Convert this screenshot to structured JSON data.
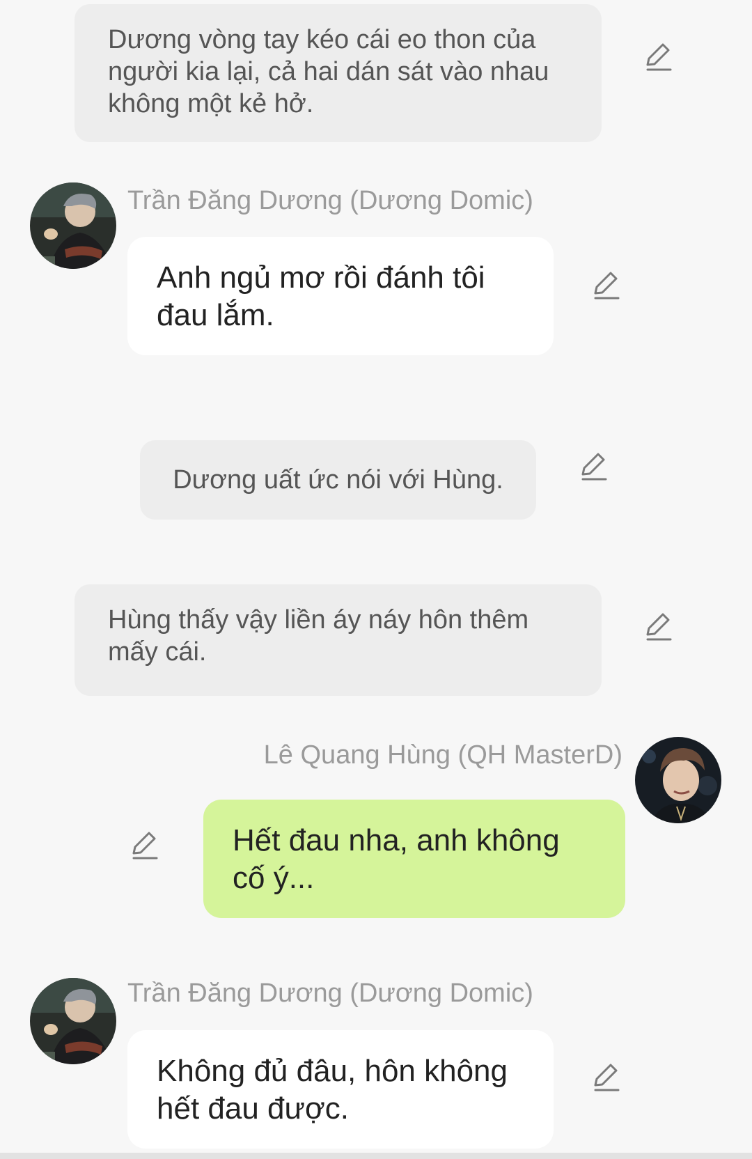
{
  "messages": [
    {
      "type": "narration",
      "text": "Dương vòng tay kéo cái eo thon của người kia lại, cả hai dán sát vào nhau không một kẻ hở."
    },
    {
      "type": "incoming",
      "sender": "Trần Đăng Dương (Dương Domic)",
      "text": "Anh ngủ mơ rồi đánh tôi đau lắm."
    },
    {
      "type": "narration",
      "text": "Dương uất ức nói với Hùng."
    },
    {
      "type": "narration",
      "text": "Hùng thấy vậy liền áy náy hôn thêm mấy cái."
    },
    {
      "type": "outgoing",
      "sender": "Lê Quang Hùng (QH MasterD)",
      "text": "Hết đau nha, anh không cố ý..."
    },
    {
      "type": "incoming",
      "sender": "Trần Đăng Dương (Dương Domic)",
      "text": "Không đủ đâu, hôn không hết đau được."
    }
  ],
  "icons": {
    "edit": "pencil-icon",
    "avatar": "avatar-photo"
  },
  "colors": {
    "background": "#f7f7f7",
    "narration_bubble": "#ededed",
    "incoming_bubble": "#ffffff",
    "outgoing_bubble": "#d5f49a",
    "sender_name": "#9a9a9a",
    "icon": "#7a7a7a"
  }
}
